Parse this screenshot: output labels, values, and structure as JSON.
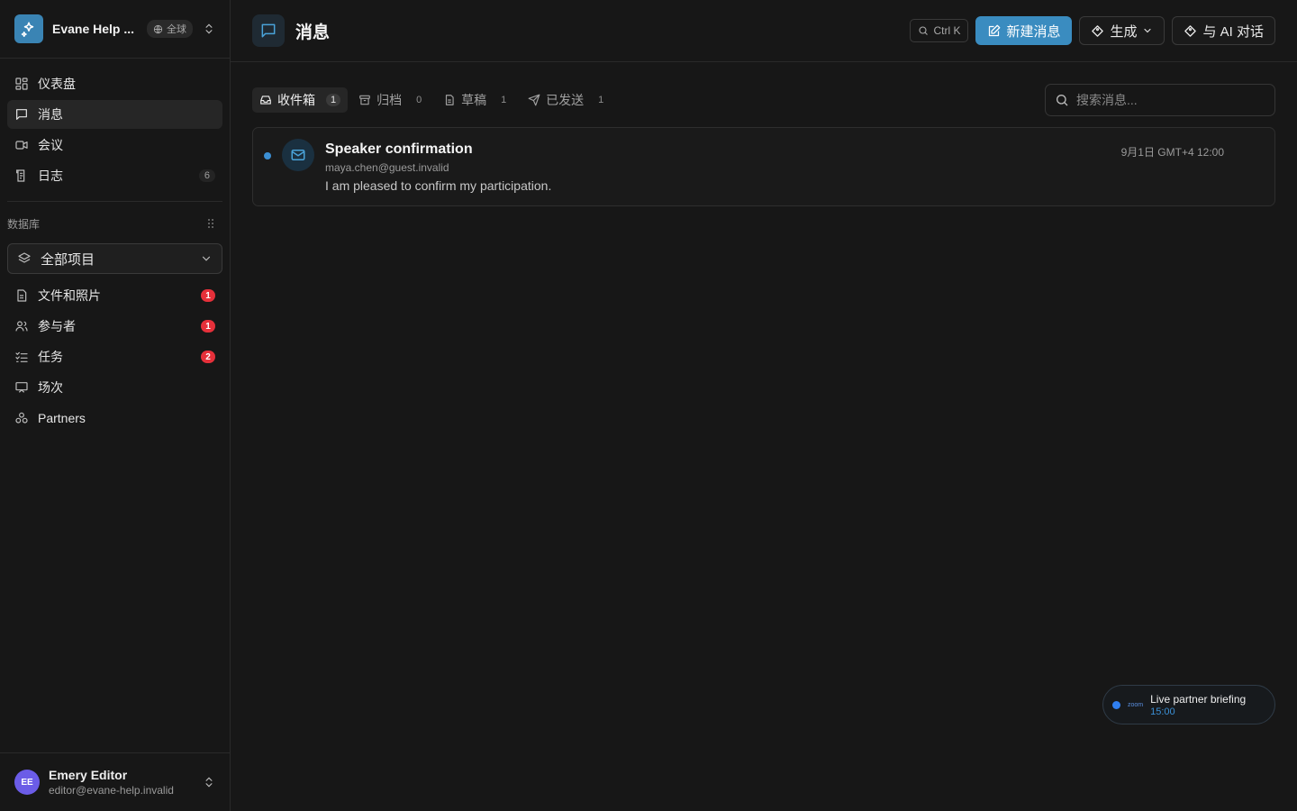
{
  "workspace": {
    "name": "Evane Help ...",
    "badge": "全球"
  },
  "nav": [
    {
      "label": "仪表盘",
      "icon": "dashboard-icon"
    },
    {
      "label": "消息",
      "icon": "message-icon",
      "active": true
    },
    {
      "label": "会议",
      "icon": "video-icon"
    },
    {
      "label": "日志",
      "icon": "log-icon",
      "count": "6"
    }
  ],
  "database": {
    "label": "数据库",
    "project_select": "全部项目",
    "items": [
      {
        "label": "文件和照片",
        "icon": "file-icon",
        "badge": "1"
      },
      {
        "label": "参与者",
        "icon": "users-icon",
        "badge": "1"
      },
      {
        "label": "任务",
        "icon": "tasks-icon",
        "badge": "2"
      },
      {
        "label": "场次",
        "icon": "session-icon"
      },
      {
        "label": "Partners",
        "icon": "partners-icon"
      }
    ]
  },
  "user": {
    "initials": "EE",
    "name": "Emery Editor",
    "email": "editor@evane-help.invalid"
  },
  "header": {
    "title": "消息",
    "shortcut": "Ctrl K",
    "new_message": "新建消息",
    "generate": "生成",
    "ai_chat": "与 AI 对话"
  },
  "tabs": [
    {
      "label": "收件箱",
      "count": "1",
      "icon": "inbox-icon",
      "active": true
    },
    {
      "label": "归档",
      "count": "0",
      "icon": "archive-icon"
    },
    {
      "label": "草稿",
      "count": "1",
      "icon": "draft-icon"
    },
    {
      "label": "已发送",
      "count": "1",
      "icon": "send-icon"
    }
  ],
  "search": {
    "placeholder": "搜索消息..."
  },
  "messages": [
    {
      "subject": "Speaker confirmation",
      "from": "maya.chen@guest.invalid",
      "preview": "I am pleased to confirm my participation.",
      "date": "9月1日 GMT+4 12:00"
    }
  ],
  "toast": {
    "brand": "zoom",
    "title": "Live partner briefing",
    "time": "15:00"
  },
  "colors": {
    "accent": "#3a8cc0",
    "badge_red": "#e5303a",
    "background": "#171717"
  }
}
